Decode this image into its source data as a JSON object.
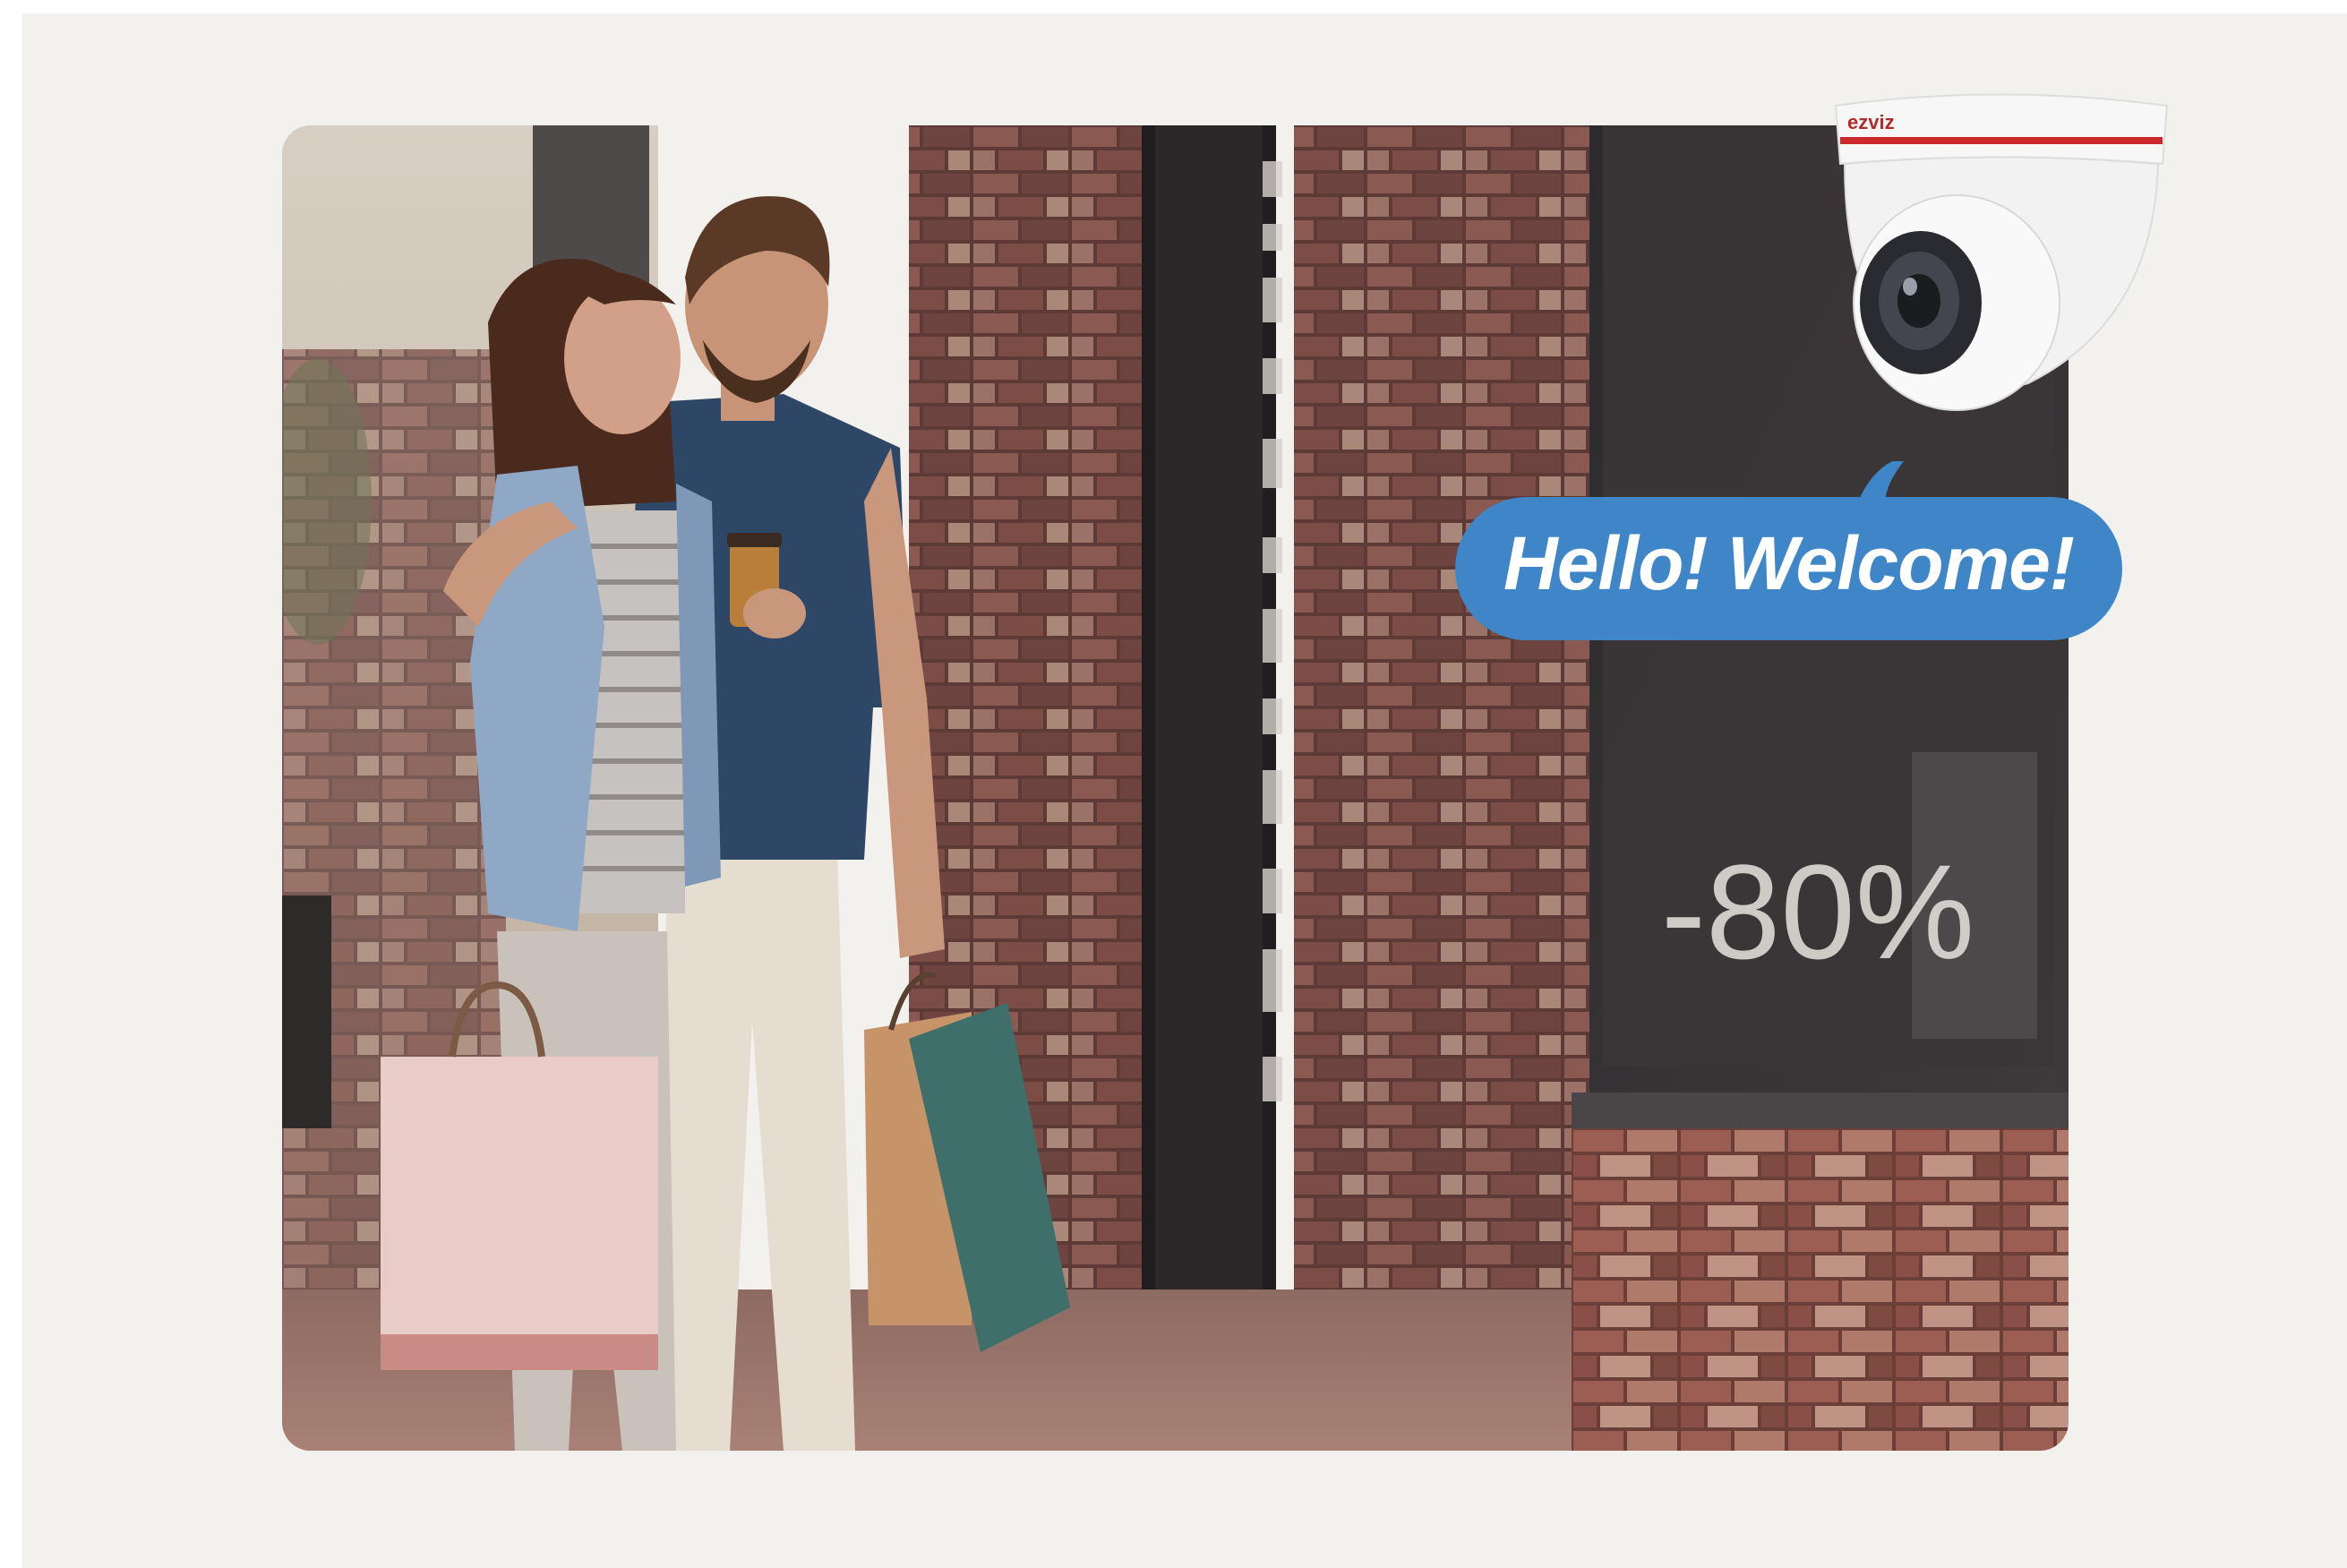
{
  "scene": {
    "speech_bubble_text": "Hello! Welcome!",
    "window_sign_text": "-80%",
    "camera_brand": "ezviz"
  },
  "colors": {
    "background": "#f2f1ee",
    "bubble": "#3f86c9",
    "brick": "#7a4a44",
    "camera_body": "#f4f4f4",
    "camera_accent": "#cc2a2a"
  }
}
